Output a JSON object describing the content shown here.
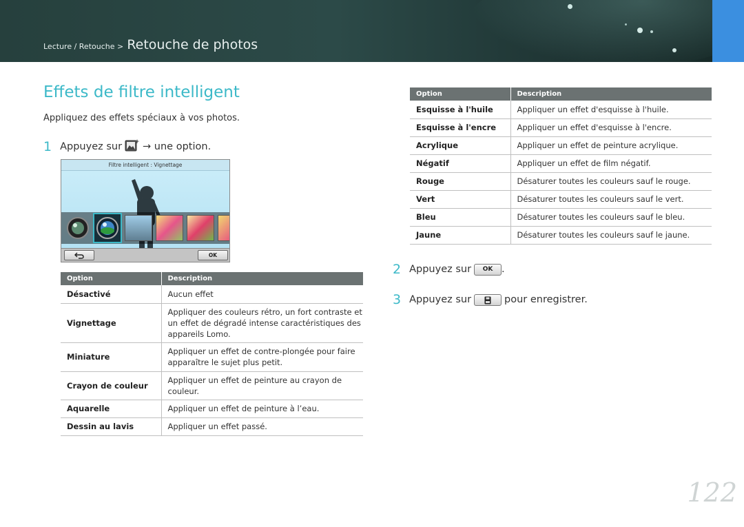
{
  "header": {
    "breadcrumb_small": "Lecture / Retouche >",
    "breadcrumb_big": "Retouche de photos"
  },
  "page_title": "Effets de filtre intelligent",
  "intro": "Appliquez des effets spéciaux à vos photos.",
  "steps": {
    "s1_num": "1",
    "s1_text_a": "Appuyez sur",
    "s1_text_b": "→ une option.",
    "s2_num": "2",
    "s2_text_a": "Appuyez sur",
    "s2_text_b": ".",
    "s3_num": "3",
    "s3_text_a": "Appuyez sur",
    "s3_text_b": "pour enregistrer."
  },
  "camera_screen": {
    "status_text": "Filtre intelligent : Vignettage",
    "ok_label": "OK",
    "back_icon": "back-arrow-icon"
  },
  "keys": {
    "ok": "OK"
  },
  "table_left": {
    "headers": [
      "Option",
      "Description"
    ],
    "rows": [
      {
        "option": "Désactivé",
        "description": "Aucun effet"
      },
      {
        "option": "Vignettage",
        "description": "Appliquer des couleurs rétro, un fort contraste et un effet de dégradé intense caractéristiques des appareils Lomo."
      },
      {
        "option": "Miniature",
        "description": "Appliquer un effet de contre-plongée pour faire apparaître le sujet plus petit."
      },
      {
        "option": "Crayon de couleur",
        "description": "Appliquer un effet de peinture au crayon de couleur."
      },
      {
        "option": "Aquarelle",
        "description": "Appliquer un effet de peinture à l’eau."
      },
      {
        "option": "Dessin au lavis",
        "description": "Appliquer un effet passé."
      }
    ]
  },
  "table_right": {
    "headers": [
      "Option",
      "Description"
    ],
    "rows": [
      {
        "option": "Esquisse à l'huile",
        "description": "Appliquer un effet d'esquisse à l'huile."
      },
      {
        "option": "Esquisse à l'encre",
        "description": "Appliquer un effet d'esquisse à l'encre."
      },
      {
        "option": "Acrylique",
        "description": "Appliquer un effet de peinture acrylique."
      },
      {
        "option": "Négatif",
        "description": "Appliquer un effet de film négatif."
      },
      {
        "option": "Rouge",
        "description": "Désaturer toutes les couleurs sauf le rouge."
      },
      {
        "option": "Vert",
        "description": "Désaturer toutes les couleurs sauf le vert."
      },
      {
        "option": "Bleu",
        "description": "Désaturer toutes les couleurs sauf le bleu."
      },
      {
        "option": "Jaune",
        "description": "Désaturer toutes les couleurs sauf le jaune."
      }
    ]
  },
  "page_number": "122",
  "colors": {
    "accent": "#3cb9c8",
    "header_bg": "#2c4a48",
    "table_header": "#6b7272",
    "corner_tab": "#3b8fe0"
  }
}
